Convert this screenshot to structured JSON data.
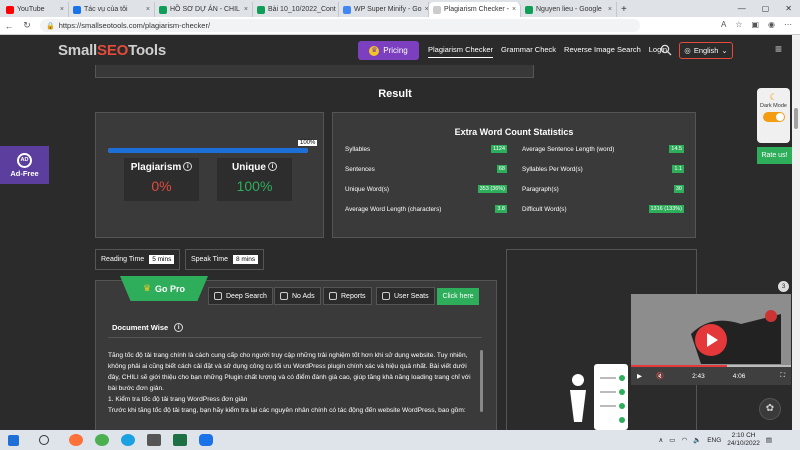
{
  "browser": {
    "tabs": [
      {
        "title": "YouTube",
        "color": "#ff0000"
      },
      {
        "title": "Tác vụ của tôi",
        "color": "#1a73e8"
      },
      {
        "title": "HỒ SƠ DỰ ÁN - CHIL",
        "color": "#0f9d58"
      },
      {
        "title": "Bài 10_10/2022_Cont",
        "color": "#0f9d58"
      },
      {
        "title": "WP Super Minify - Go",
        "color": "#4285f4"
      },
      {
        "title": "Plagiarism Checker -",
        "color": "#cccccc",
        "active": true
      },
      {
        "title": "Nguyen lieu - Google",
        "color": "#0f9d58"
      }
    ],
    "new_tab": "+",
    "url": "https://smallseotools.com/plagiarism-checker/"
  },
  "header": {
    "logo_a": "Small",
    "logo_seo": "SEO",
    "logo_b": "Tools",
    "pricing": "Pricing",
    "nav": [
      "Plagiarism Checker",
      "Grammar Check",
      "Reverse Image Search",
      "Login"
    ],
    "language": "English"
  },
  "result_title": "Result",
  "progress": {
    "label": "100%",
    "fraction": 1.0
  },
  "plagiarism": {
    "label": "Plagiarism",
    "value": "0%"
  },
  "unique": {
    "label": "Unique",
    "value": "100%"
  },
  "stats": {
    "title": "Extra Word Count Statistics",
    "left": [
      {
        "label": "Syllables",
        "value": "1124"
      },
      {
        "label": "Sentences",
        "value": "68"
      },
      {
        "label": "Unique Word(s)",
        "value": "353 (36%)"
      },
      {
        "label": "Average Word Length (characters)",
        "value": "3.8"
      }
    ],
    "right": [
      {
        "label": "Average Sentence Length (word)",
        "value": "14.5"
      },
      {
        "label": "Syllables Per Word(s)",
        "value": "1.1"
      },
      {
        "label": "Paragraph(s)",
        "value": "30"
      },
      {
        "label": "Difficult Word(s)",
        "value": "1316 (133%)"
      }
    ]
  },
  "reading_time": {
    "label": "Reading Time",
    "value": "5 mins"
  },
  "speak_time": {
    "label": "Speak Time",
    "value": "8 mins"
  },
  "gopro": {
    "label": "Go Pro",
    "features": [
      "Deep Search",
      "No Ads",
      "Reports",
      "User Seats"
    ],
    "cta": "Click here"
  },
  "document": {
    "title": "Document Wise",
    "paragraphs": [
      "Tăng tốc độ tải trang chính là cách cung cấp cho người truy cập những trải nghiệm tốt hơn khi sử dụng website. Tuy nhiên, không phải ai cũng biết cách cải đặt và sử dụng công cụ tối ưu WordPress plugin chính xác và hiệu quả nhất. Bài viết dưới đây, CHILI sẽ giới thiệu cho bạn những Plugin chất lượng và có điểm đánh giá cao, giúp tăng khả năng loading trang chỉ với bài bước đơn giản.",
      "1. Kiểm tra tốc độ tải trang WordPress đơn giản",
      "Trước khi tăng tốc độ tải trang, bạn hãy kiểm tra lại các nguyên nhân chính có tác động đến website WordPress, bao gồm:"
    ]
  },
  "sidebar": {
    "ad_free": "Ad-Free",
    "ad_badge": "AD",
    "dark_mode": "Dark Mode",
    "rate_us": "Rate us!"
  },
  "video": {
    "current": "2:43",
    "duration": "4:06",
    "progress": 0.6,
    "badge": "3"
  },
  "taskbar": {
    "lang": "ENG",
    "time": "2:10 CH",
    "date": "24/10/2022"
  }
}
